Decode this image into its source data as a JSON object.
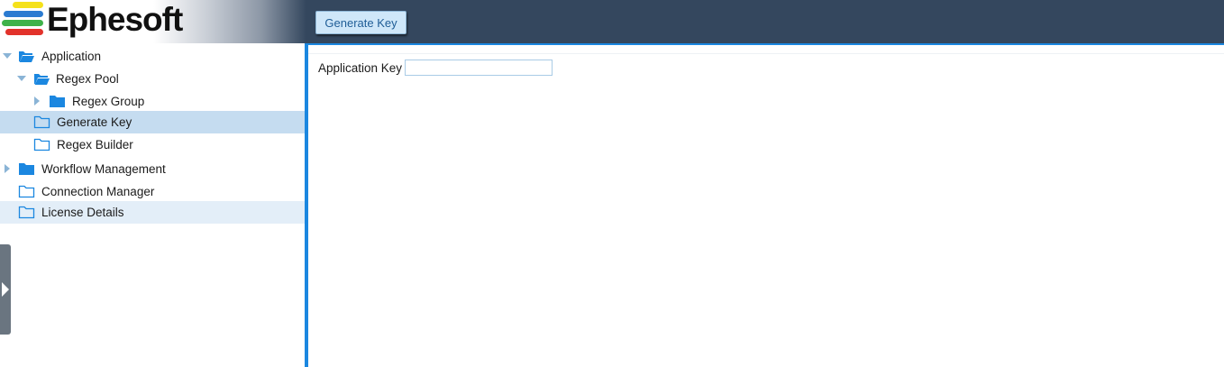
{
  "header": {
    "logo_text": "Ephesoft",
    "generate_button_label": "Generate Key"
  },
  "tree": [
    {
      "label": "Application",
      "expanded": true,
      "icon": "folder-open-icon"
    },
    {
      "label": "Regex Pool",
      "expanded": true,
      "icon": "folder-open-icon"
    },
    {
      "label": "Regex Group",
      "expanded": false,
      "icon": "folder-filled-icon"
    },
    {
      "label": "Generate Key",
      "selected": true,
      "icon": "folder-outline-icon"
    },
    {
      "label": "Regex Builder",
      "icon": "folder-outline-icon"
    },
    {
      "label": "Workflow Management",
      "expanded": false,
      "icon": "folder-filled-icon"
    },
    {
      "label": "Connection Manager",
      "icon": "folder-outline-icon"
    },
    {
      "label": "License Details",
      "icon": "folder-outline-icon"
    }
  ],
  "content": {
    "application_key_label": "Application Key",
    "application_key_value": ""
  },
  "colors": {
    "header_bg": "#34475e",
    "accent": "#1b87e0",
    "folder": "#1b87e0",
    "selected_row": "#c5dcf0"
  }
}
